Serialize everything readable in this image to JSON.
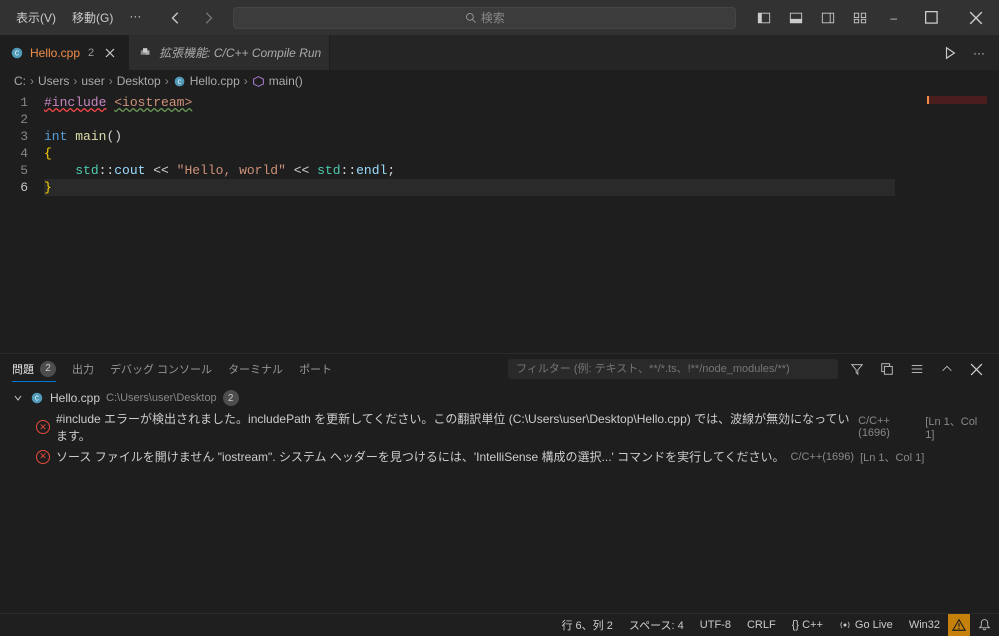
{
  "menu": {
    "view": "表示(V)",
    "go": "移動(G)",
    "more": "···"
  },
  "search": {
    "placeholder": "検索"
  },
  "tabs": {
    "active": {
      "name": "Hello.cpp",
      "badge": "2"
    },
    "ext": {
      "name": "拡張機能: C/C++ Compile Run"
    }
  },
  "breadcrumbs": {
    "items": [
      "C:",
      "Users",
      "user",
      "Desktop",
      "Hello.cpp",
      "main()"
    ]
  },
  "code": {
    "l1a": "#include",
    "l1b": "<iostream>",
    "l3a": "int",
    "l3b": "main",
    "l3c": "()",
    "l4": "{",
    "l5ns": "std",
    "l5colon": "::",
    "l5cout": "cout",
    "l5op": " << ",
    "l5str": "\"Hello, world\"",
    "l5endl": "endl",
    "l5semi": ";",
    "l6": "}"
  },
  "panel": {
    "tabs": {
      "problems": "問題",
      "problems_count": "2",
      "output": "出力",
      "console": "デバッグ コンソール",
      "terminal": "ターミナル",
      "ports": "ポート"
    },
    "filter_placeholder": "フィルター (例: テキスト、**/*.ts、!**/node_modules/**)",
    "file": {
      "name": "Hello.cpp",
      "path": "C:\\Users\\user\\Desktop",
      "count": "2"
    },
    "errors": [
      {
        "msg": "#include エラーが検出されました。includePath を更新してください。この翻訳単位 (C:\\Users\\user\\Desktop\\Hello.cpp) では、波線が無効になっています。",
        "src": "C/C++(1696)",
        "loc": "[Ln 1、Col 1]"
      },
      {
        "msg": "ソース ファイルを開けません \"iostream\". システム ヘッダーを見つけるには、'IntelliSense 構成の選択...' コマンドを実行してください。",
        "src": "C/C++(1696)",
        "loc": "[Ln 1、Col 1]"
      }
    ]
  },
  "status": {
    "line_col": "行 6、列 2",
    "spaces": "スペース: 4",
    "encoding": "UTF-8",
    "eol": "CRLF",
    "lang": "{} C++",
    "golive": "Go Live",
    "win32": "Win32"
  }
}
